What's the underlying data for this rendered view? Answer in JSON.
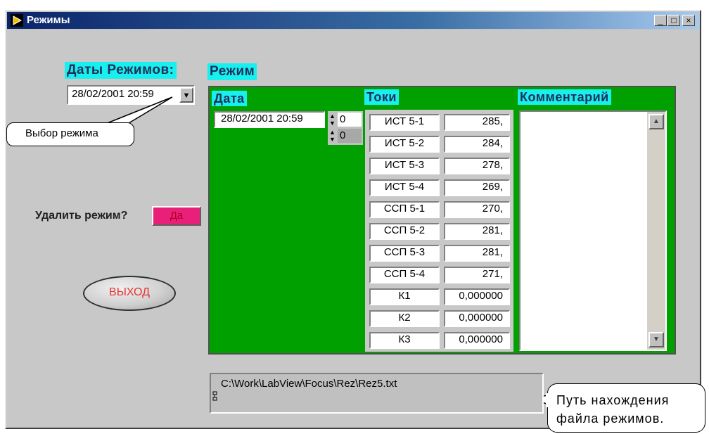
{
  "window": {
    "title": "Режимы",
    "minimize": "_",
    "maximize": "□",
    "close": "×"
  },
  "left": {
    "dates_label": "Даты Режимов:",
    "dates_value": "28/02/2001 20:59",
    "dropdown_glyph": "▼",
    "delete_label": "Удалить режим?",
    "delete_button": "Да",
    "exit_button": "ВЫХОД"
  },
  "callouts": {
    "select_mode": "Выбор режима",
    "file_path_line1": "Путь нахождения",
    "file_path_line2": "файла режимов."
  },
  "mode": {
    "label": "Режим",
    "date_header": "Дата",
    "date_value": "28/02/2001 20:59",
    "spinner1": "0",
    "spinner2": "0",
    "currents_header": "Токи",
    "comment_header": "Комментарий",
    "currents": [
      {
        "name": "ИСТ 5-1",
        "value": "285,"
      },
      {
        "name": "ИСТ 5-2",
        "value": "284,"
      },
      {
        "name": "ИСТ 5-3",
        "value": "278,"
      },
      {
        "name": "ИСТ 5-4",
        "value": "269,"
      },
      {
        "name": "ССП 5-1",
        "value": "270,"
      },
      {
        "name": "ССП 5-2",
        "value": "281,"
      },
      {
        "name": "ССП 5-3",
        "value": "281,"
      },
      {
        "name": "ССП 5-4",
        "value": "271,"
      },
      {
        "name": "К1",
        "value": "0,000000"
      },
      {
        "name": "К2",
        "value": "0,000000"
      },
      {
        "name": "К3",
        "value": "0,000000"
      }
    ],
    "comment_text": ""
  },
  "path": {
    "value": "C:\\Work\\LabView\\Focus\\Rez\\Rez5.txt"
  },
  "colors": {
    "title_bar": "#0a246a",
    "label_background": "#18f0f0",
    "panel_green": "#00a000",
    "delete_button": "#e8207a",
    "exit_text": "#e83030"
  }
}
